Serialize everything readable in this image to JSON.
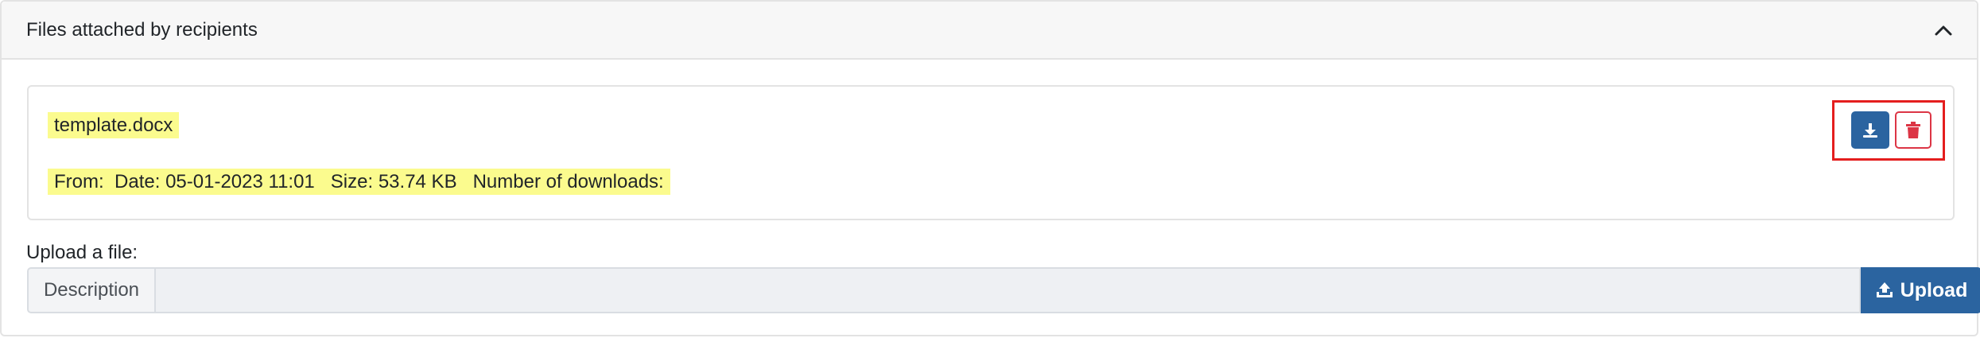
{
  "panel": {
    "title": "Files attached by recipients"
  },
  "file": {
    "name": "template.docx",
    "from_label": "From:",
    "date_label": "Date:",
    "date_value": "05-01-2023 11:01",
    "size_label": "Size:",
    "size_value": "53.74 KB",
    "downloads_label": "Number of downloads:"
  },
  "actions": {
    "download_icon": "download-icon",
    "delete_icon": "trash-icon"
  },
  "upload": {
    "label": "Upload a file:",
    "description_addon": "Description",
    "input_value": "",
    "button_label": "Upload",
    "button_icon": "upload-icon"
  },
  "colors": {
    "primary": "#2b64a0",
    "danger": "#dc3545",
    "highlight": "#fbfb8e",
    "annotation_box": "#e41e1e"
  }
}
